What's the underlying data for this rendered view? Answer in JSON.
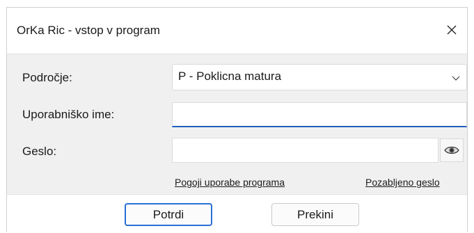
{
  "window": {
    "title": "OrKa Ric - vstop v program"
  },
  "form": {
    "area_label": "Področje:",
    "area_value": "P - Poklicna matura",
    "username_label": "Uporabniško ime:",
    "username_value": "",
    "password_label": "Geslo:",
    "password_value": ""
  },
  "links": {
    "terms": "Pogoji uporabe programa",
    "forgot_password": "Pozabljeno geslo"
  },
  "buttons": {
    "confirm": "Potrdi",
    "cancel": "Prekini"
  },
  "icons": {
    "close": "close-icon",
    "dropdown": "chevron-down-icon",
    "show_password": "eye-icon"
  },
  "colors": {
    "accent": "#1f5fbf",
    "content_bg": "#f0f0f0"
  }
}
